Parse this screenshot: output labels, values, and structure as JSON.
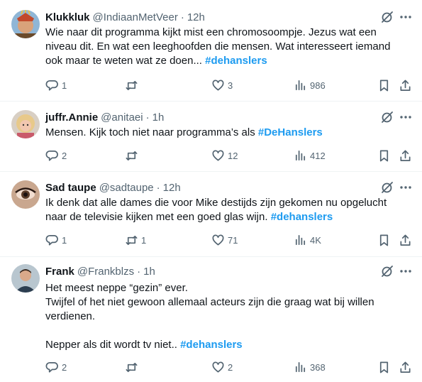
{
  "tweets": [
    {
      "name": "Klukkluk",
      "handle": "@IndiaanMetVeer",
      "time": "12h",
      "text": "Wie naar dit programma kijkt mist een chromosoompje. Jezus wat een niveau dit. En wat een leeghoofden die mensen. Wat interesseert iemand ook maar te weten wat ze doen... ",
      "hashtag": "#dehanslers",
      "replies": "1",
      "retweets": "",
      "likes": "3",
      "views": "986"
    },
    {
      "name": "juffr.Annie",
      "handle": "@anitaei",
      "time": "1h",
      "text": "Mensen. Kijk toch niet naar programma’s als ",
      "hashtag": "#DeHanslers",
      "replies": "2",
      "retweets": "",
      "likes": "12",
      "views": "412"
    },
    {
      "name": "Sad taupe",
      "handle": "@sadtaupe",
      "time": "12h",
      "text": "Ik denk dat alle dames die voor Mike destijds zijn gekomen nu opgelucht naar de televisie kijken met een goed glas wijn. ",
      "hashtag": "#dehanslers",
      "replies": "1",
      "retweets": "1",
      "likes": "71",
      "views": "4K"
    },
    {
      "name": "Frank",
      "handle": "@Frankblzs",
      "time": "1h",
      "line1": "Het meest neppe “gezin” ever.",
      "line2": "Twijfel of het niet gewoon allemaal acteurs zijn die graag wat bij willen verdienen.",
      "line3": "Nepper als dit wordt tv niet.. ",
      "hashtag": "#dehanslers",
      "replies": "2",
      "retweets": "",
      "likes": "2",
      "views": "368"
    }
  ],
  "separator": "·",
  "icons": {
    "reply": "reply-icon",
    "retweet": "retweet-icon",
    "like": "heart-icon",
    "views": "views-icon",
    "bookmark": "bookmark-icon",
    "share": "share-icon",
    "grok": "grok-icon",
    "more": "more-icon"
  },
  "colors": {
    "text": "#0f1419",
    "secondary": "#536471",
    "hashtag": "#1d9bf0",
    "border": "#eff3f4"
  }
}
